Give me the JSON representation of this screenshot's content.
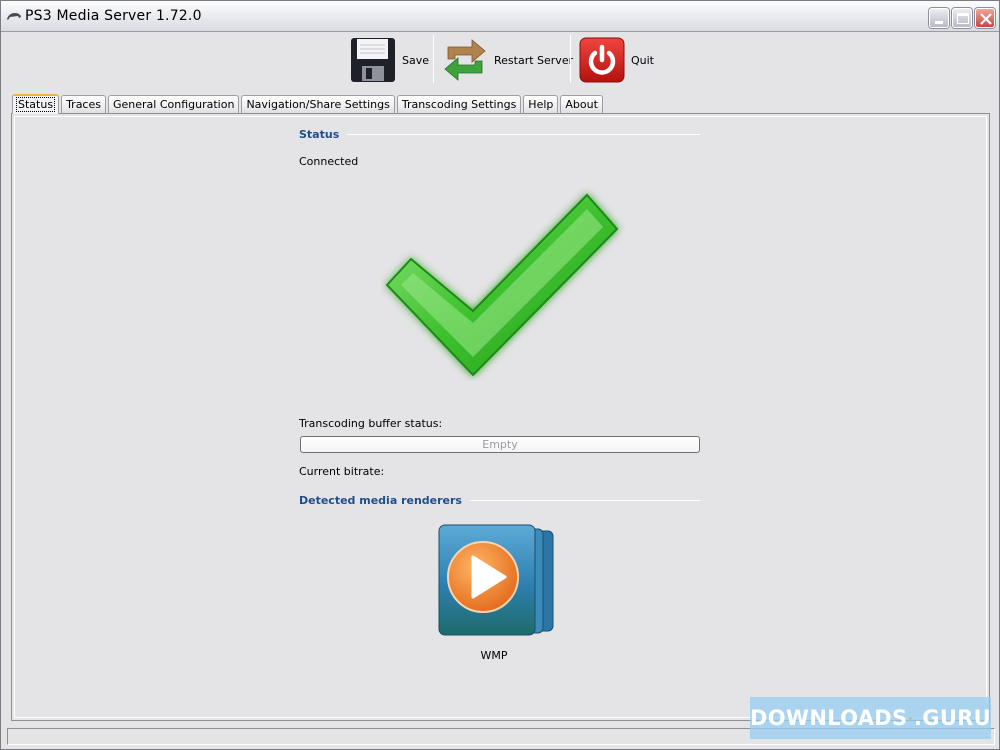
{
  "window": {
    "title": "PS3 Media Server 1.72.0",
    "controls": {
      "minimize": "minimize",
      "maximize": "maximize",
      "close": "close"
    }
  },
  "toolbar": {
    "save_label": "Save",
    "restart_label": "Restart Server",
    "quit_label": "Quit"
  },
  "tabs": [
    {
      "label": "Status",
      "active": true
    },
    {
      "label": "Traces"
    },
    {
      "label": "General Configuration"
    },
    {
      "label": "Navigation/Share Settings"
    },
    {
      "label": "Transcoding Settings"
    },
    {
      "label": "Help"
    },
    {
      "label": "About"
    }
  ],
  "status": {
    "section_title": "Status",
    "connection": "Connected",
    "connection_icon": "checkmark-icon",
    "buffer_label": "Transcoding buffer status:",
    "buffer_text": "Empty",
    "buffer_fill_percent": 0,
    "bitrate_label": "Current bitrate:",
    "bitrate_value": "",
    "renderers_title": "Detected media renderers",
    "renderers": [
      {
        "name": "WMP",
        "icon": "windows-media-player-icon"
      }
    ]
  },
  "watermark": {
    "left": "DOWNLOADS",
    "right": ".GURU"
  },
  "colors": {
    "section_title": "#1F4E8C",
    "accent_tab": "#F2B33E",
    "close_button": "#C24A3F"
  }
}
